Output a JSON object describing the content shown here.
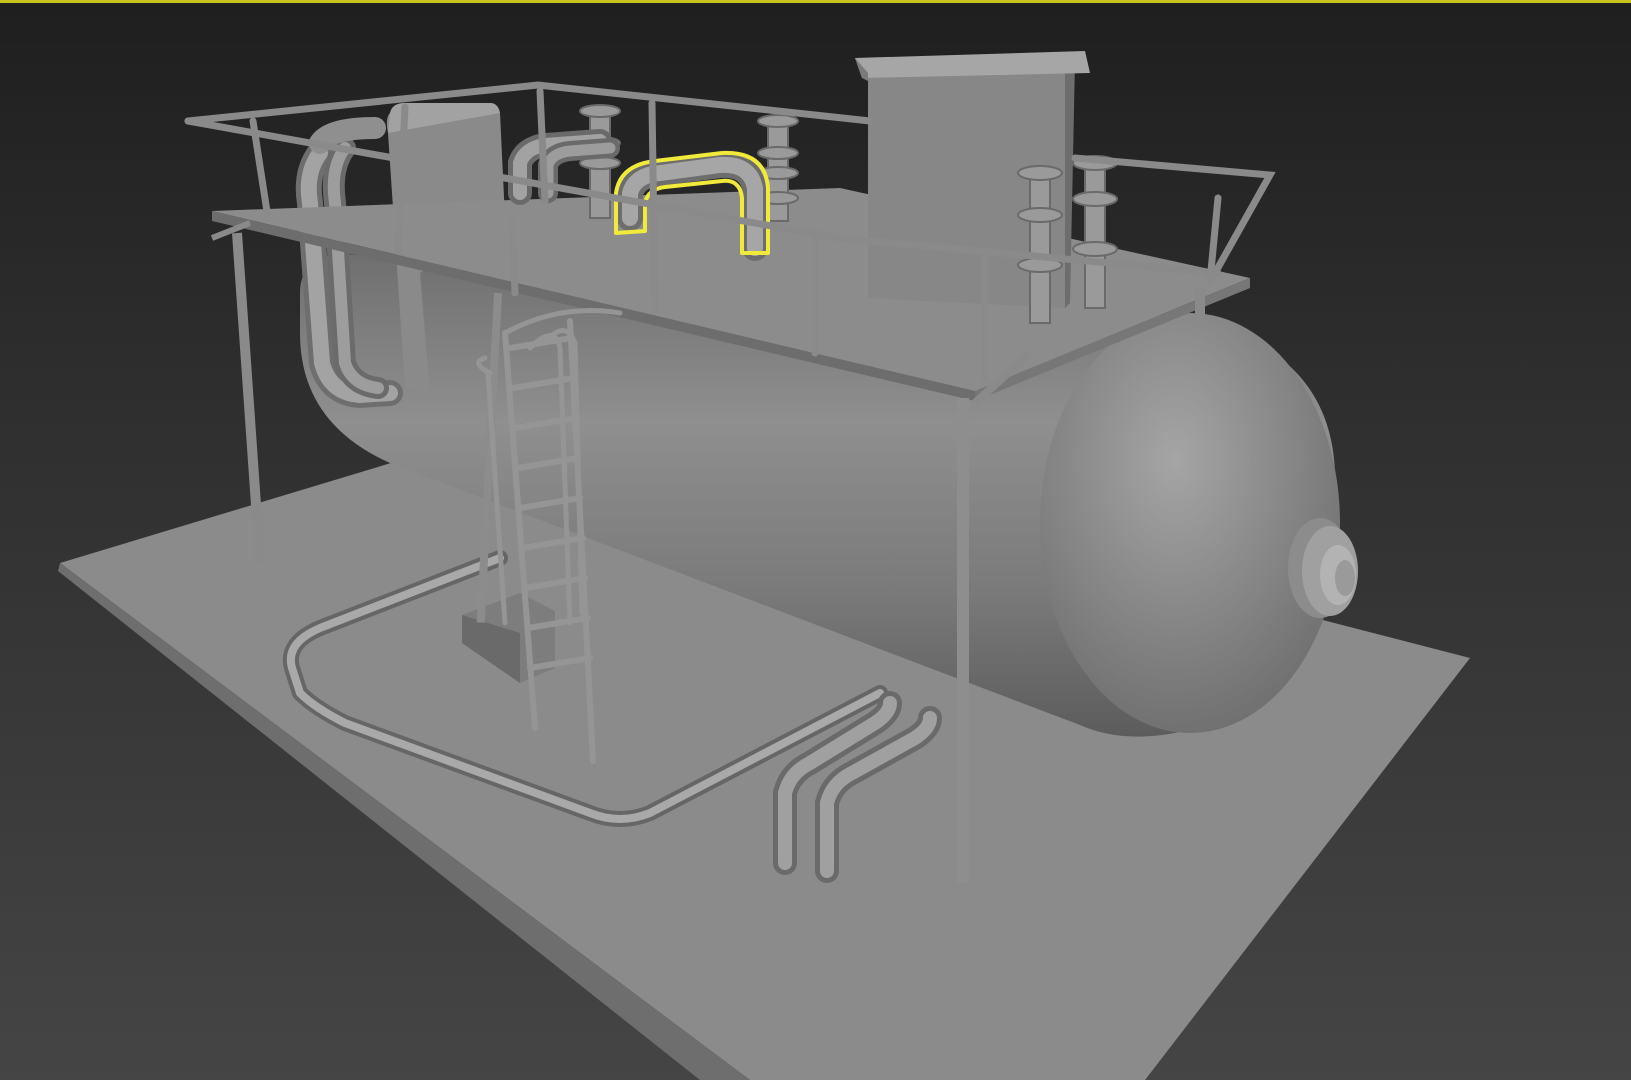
{
  "viewport": {
    "display_mode": "shaded",
    "active_border_color": "#c7c21d",
    "selection_highlight_color": "#f2ea3a",
    "background_top": "#1f1f1f",
    "background_bottom": "#454545"
  },
  "scene": {
    "objects": [
      {
        "name": "ground-slab",
        "selected": false
      },
      {
        "name": "horizontal-pressure-vessel",
        "selected": false
      },
      {
        "name": "top-platform",
        "selected": false
      },
      {
        "name": "guard-railing",
        "selected": false
      },
      {
        "name": "access-ladder",
        "selected": false
      },
      {
        "name": "vertical-box-tower",
        "selected": false
      },
      {
        "name": "u-bend-pipe",
        "selected": true
      },
      {
        "name": "flanged-nozzles",
        "selected": false
      },
      {
        "name": "ground-loop-pipe",
        "selected": false
      },
      {
        "name": "outlet-elbow-pipes",
        "selected": false
      }
    ]
  }
}
